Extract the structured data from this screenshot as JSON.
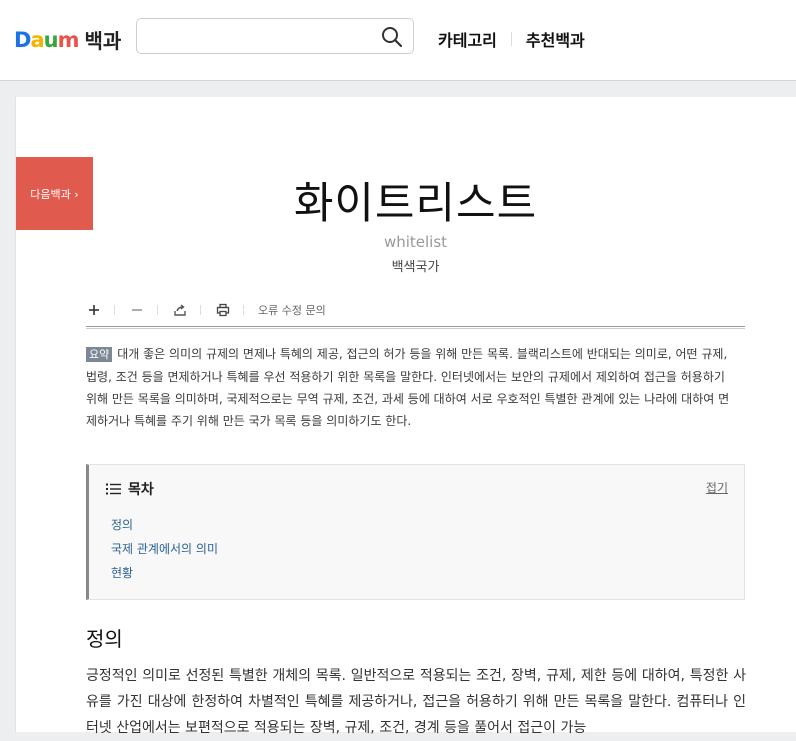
{
  "header": {
    "logo_letters": [
      "D",
      "a",
      "u",
      "m"
    ],
    "logo_colors": [
      "#1a74e8",
      "#f4b400",
      "#37a73b",
      "#e8534a"
    ],
    "service_name": "백과",
    "search": {
      "value": "",
      "placeholder": ""
    },
    "nav": [
      "카테고리",
      "추천백과"
    ]
  },
  "page": {
    "next_badge": "다음백과 ›",
    "title": "화이트리스트",
    "title_en": "whitelist",
    "source": "백색국가",
    "toolbar": {
      "icons": [
        "plus-icon",
        "minus-icon",
        "share-icon",
        "print-icon"
      ],
      "report": "오류 수정 문의"
    },
    "summary_label": "요약",
    "summary_text": "대개 좋은 의미의 규제의 면제나 특혜의 제공, 접근의 허가 등을 위해 만든 목록. 블랙리스트에 반대되는 의미로, 어떤 규제, 법령, 조건 등을 면제하거나 특혜를 우선 적용하기 위한 목록을 말한다. 인터넷에서는 보안의 규제에서 제외하여 접근을 허용하기 위해 만든 목록을 의미하며, 국제적으로는 무역 규제, 조건, 과세 등에 대하여 서로 우호적인 특별한 관계에 있는 나라에 대하여 면제하거나 특혜를 주기 위해 만든 국가 목록 등을 의미하기도 한다.",
    "toc": {
      "title": "목차",
      "fold": "접기",
      "items": [
        "정의",
        "국제 관계에서의 의미",
        "현황"
      ]
    },
    "section_title": "정의",
    "body_text": "긍정적인 의미로 선정된 특별한 개체의 목록. 일반적으로 적용되는 조건, 장벽, 규제, 제한 등에 대하여, 특정한 사유를 가진 대상에 한정하여 차별적인 특혜를 제공하거나, 접근을 허용하기 위해 만든 목록을 말한다. 컴퓨터나 인터넷 산업에서는 보편적으로 적용되는 장벽, 규제, 조건, 경계 등을 풀어서 접근이 가능"
  }
}
